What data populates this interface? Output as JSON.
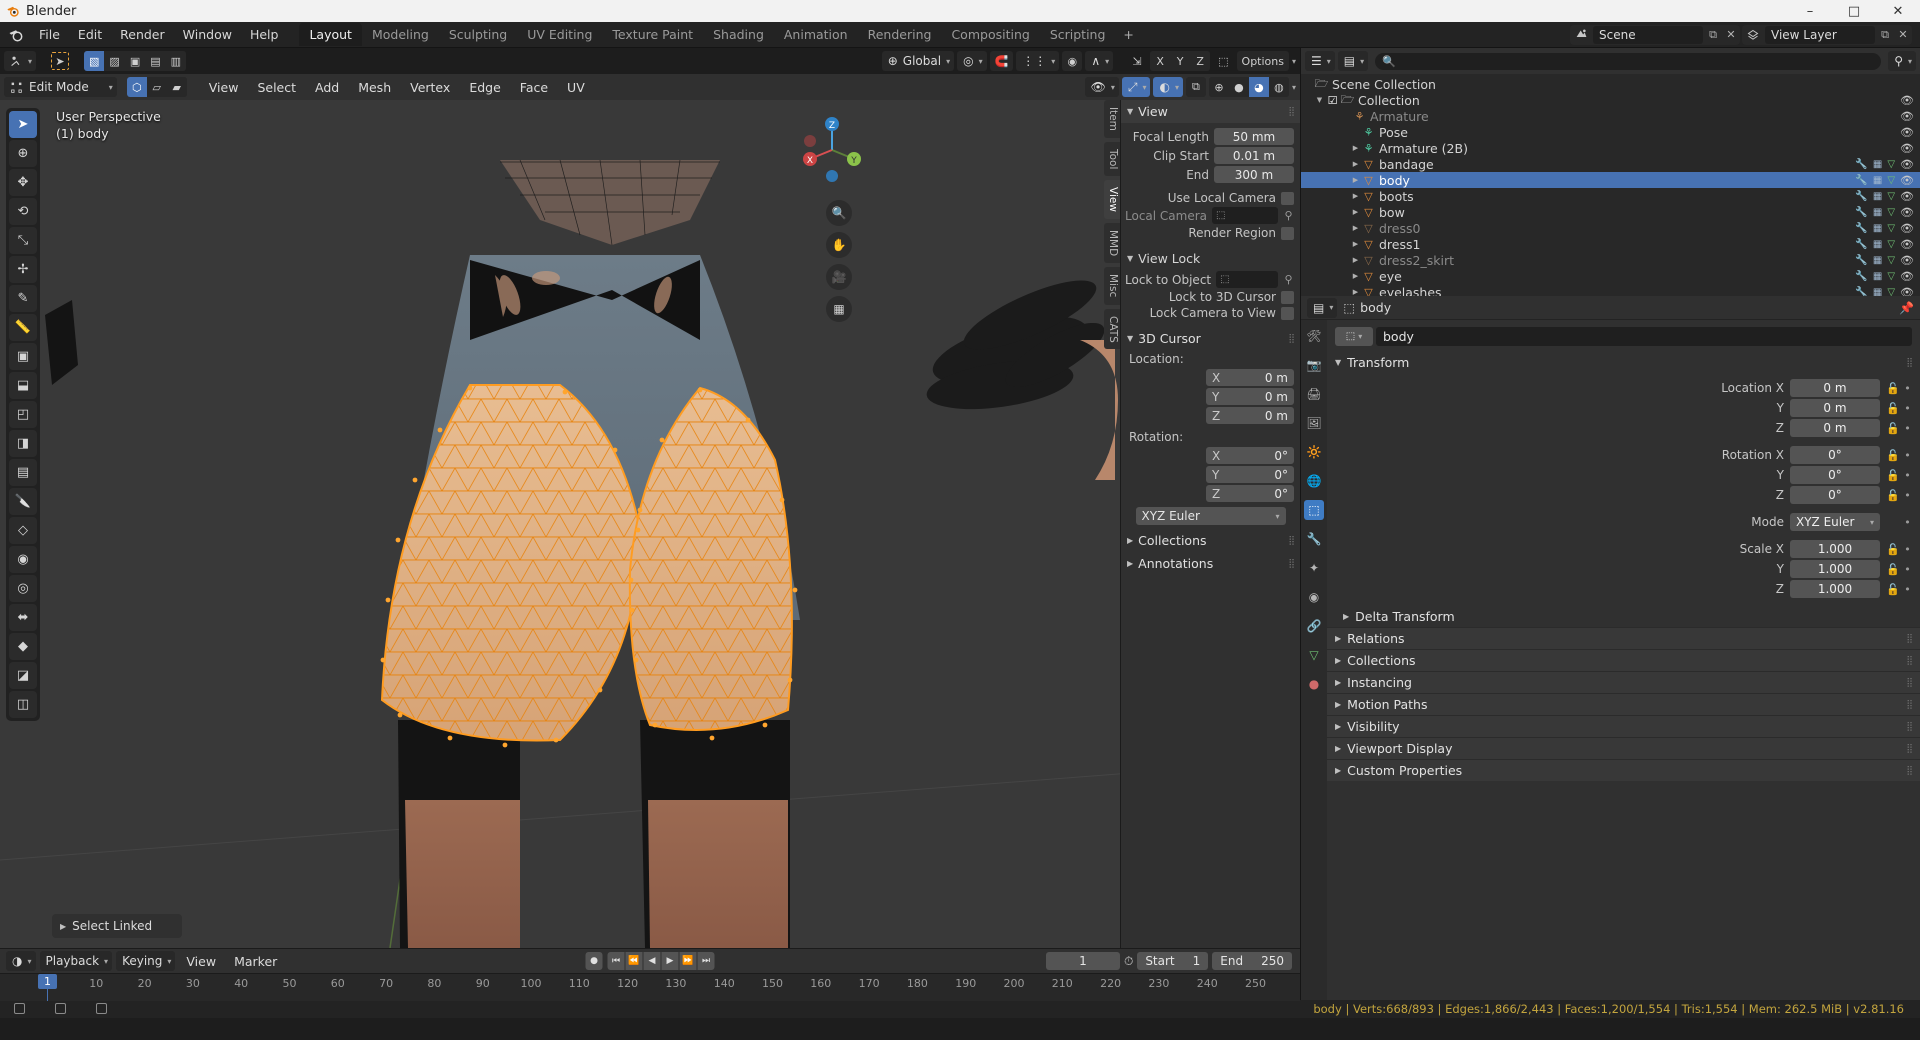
{
  "window": {
    "title": "Blender",
    "buttons": [
      "–",
      "□",
      "✕"
    ]
  },
  "topbar": {
    "menus": [
      "File",
      "Edit",
      "Render",
      "Window",
      "Help"
    ],
    "workspaces": [
      "Layout",
      "Modeling",
      "Sculpting",
      "UV Editing",
      "Texture Paint",
      "Shading",
      "Animation",
      "Rendering",
      "Compositing",
      "Scripting"
    ],
    "add_workspace": "+",
    "active_workspace": "Layout",
    "scene_name": "Scene",
    "view_layer_name": "View Layer"
  },
  "viewport": {
    "header": {
      "mode": "Edit Mode",
      "menus": [
        "View",
        "Select",
        "Add",
        "Mesh",
        "Vertex",
        "Edge",
        "Face",
        "UV"
      ],
      "transform_orientation": "Global",
      "options_label": "Options",
      "axis_labels": [
        "X",
        "Y",
        "Z"
      ]
    },
    "overlay_text_line1": "User Perspective",
    "overlay_text_line2": "(1) body",
    "operator_panel": "Select Linked",
    "gizmo_axes": [
      "X",
      "Y",
      "Z"
    ]
  },
  "npanel": {
    "tabs": [
      "Item",
      "Tool",
      "View",
      "MMD",
      "Misc",
      "CATS"
    ],
    "active_tab": "View",
    "sections": {
      "view": {
        "title": "View",
        "rows": [
          {
            "label": "Focal Length",
            "value": "50 mm"
          },
          {
            "label": "Clip Start",
            "value": "0.01 m"
          },
          {
            "label": "End",
            "value": "300 m"
          }
        ],
        "use_local_camera": "Use Local Camera",
        "local_camera": "Local Camera",
        "render_region": "Render Region"
      },
      "view_lock": {
        "title": "View Lock",
        "lock_to_object": "Lock to Object",
        "lock_to_3d_cursor": "Lock to 3D Cursor",
        "lock_camera_to_view": "Lock Camera to View"
      },
      "cursor": {
        "title": "3D Cursor",
        "location_label": "Location:",
        "location": [
          {
            "axis": "X",
            "value": "0 m"
          },
          {
            "axis": "Y",
            "value": "0 m"
          },
          {
            "axis": "Z",
            "value": "0 m"
          }
        ],
        "rotation_label": "Rotation:",
        "rotation": [
          {
            "axis": "X",
            "value": "0°"
          },
          {
            "axis": "Y",
            "value": "0°"
          },
          {
            "axis": "Z",
            "value": "0°"
          }
        ],
        "rotation_mode": "XYZ Euler"
      },
      "collections": "Collections",
      "annotations": "Annotations"
    }
  },
  "timeline": {
    "menus": [
      "Playback",
      "Keying",
      "View",
      "Marker"
    ],
    "current_frame": "1",
    "start_label": "Start",
    "start_value": "1",
    "end_label": "End",
    "end_value": "250",
    "ticks": [
      "10",
      "20",
      "30",
      "40",
      "50",
      "60",
      "70",
      "80",
      "90",
      "100",
      "110",
      "120",
      "130",
      "140",
      "150",
      "160",
      "170",
      "180",
      "190",
      "200",
      "210",
      "220",
      "230",
      "240",
      "250"
    ],
    "playhead_frame": "1"
  },
  "outliner": {
    "root": "Scene Collection",
    "collection": "Collection",
    "items": [
      {
        "name": "Armature",
        "icon": "armature-icon",
        "depth": 3,
        "dim": true,
        "selected": false,
        "expandable": false
      },
      {
        "name": "Pose",
        "icon": "pose-icon",
        "depth": 4,
        "dim": false,
        "selected": false,
        "expandable": false
      },
      {
        "name": "Armature (2B)",
        "icon": "armature-data-icon",
        "depth": 4,
        "dim": false,
        "selected": false,
        "expandable": true
      },
      {
        "name": "bandage",
        "icon": "mesh-icon",
        "depth": 4,
        "dim": false,
        "selected": false,
        "expandable": true
      },
      {
        "name": "body",
        "icon": "mesh-icon",
        "depth": 4,
        "dim": false,
        "selected": true,
        "expandable": true
      },
      {
        "name": "boots",
        "icon": "mesh-icon",
        "depth": 4,
        "dim": false,
        "selected": false,
        "expandable": true
      },
      {
        "name": "bow",
        "icon": "mesh-icon",
        "depth": 4,
        "dim": false,
        "selected": false,
        "expandable": true
      },
      {
        "name": "dress0",
        "icon": "mesh-icon",
        "depth": 4,
        "dim": true,
        "selected": false,
        "expandable": true
      },
      {
        "name": "dress1",
        "icon": "mesh-icon",
        "depth": 4,
        "dim": false,
        "selected": false,
        "expandable": true
      },
      {
        "name": "dress2_skirt",
        "icon": "mesh-icon",
        "depth": 4,
        "dim": true,
        "selected": false,
        "expandable": true
      },
      {
        "name": "eye",
        "icon": "mesh-icon",
        "depth": 4,
        "dim": false,
        "selected": false,
        "expandable": true
      },
      {
        "name": "eyelashes",
        "icon": "mesh-icon",
        "depth": 4,
        "dim": false,
        "selected": false,
        "expandable": true
      }
    ]
  },
  "properties": {
    "breadcrumb_object": "body",
    "datablock_name": "body",
    "transform": {
      "title": "Transform",
      "rows": [
        {
          "label": "Location X",
          "value": "0 m"
        },
        {
          "label": "Y",
          "value": "0 m"
        },
        {
          "label": "Z",
          "value": "0 m"
        },
        {
          "label": "Rotation X",
          "value": "0°"
        },
        {
          "label": "Y",
          "value": "0°"
        },
        {
          "label": "Z",
          "value": "0°"
        }
      ],
      "mode_label": "Mode",
      "mode_value": "XYZ Euler",
      "scale_rows": [
        {
          "label": "Scale X",
          "value": "1.000"
        },
        {
          "label": "Y",
          "value": "1.000"
        },
        {
          "label": "Z",
          "value": "1.000"
        }
      ],
      "delta_transform": "Delta Transform"
    },
    "panels": [
      "Relations",
      "Collections",
      "Instancing",
      "Motion Paths",
      "Visibility",
      "Viewport Display",
      "Custom Properties"
    ]
  },
  "statusbar": {
    "stats": "body | Verts:668/893 | Edges:1,866/2,443 | Faces:1,200/1,554 | Tris:1,554 | Mem: 262.5 MiB | v2.81.16"
  },
  "colors": {
    "accent_blue": "#4772b3",
    "mesh_orange": "#e8820c",
    "stats_yellow": "#c3a53e",
    "bg_dark": "#1d1d1d",
    "panel_bg": "#303030"
  }
}
